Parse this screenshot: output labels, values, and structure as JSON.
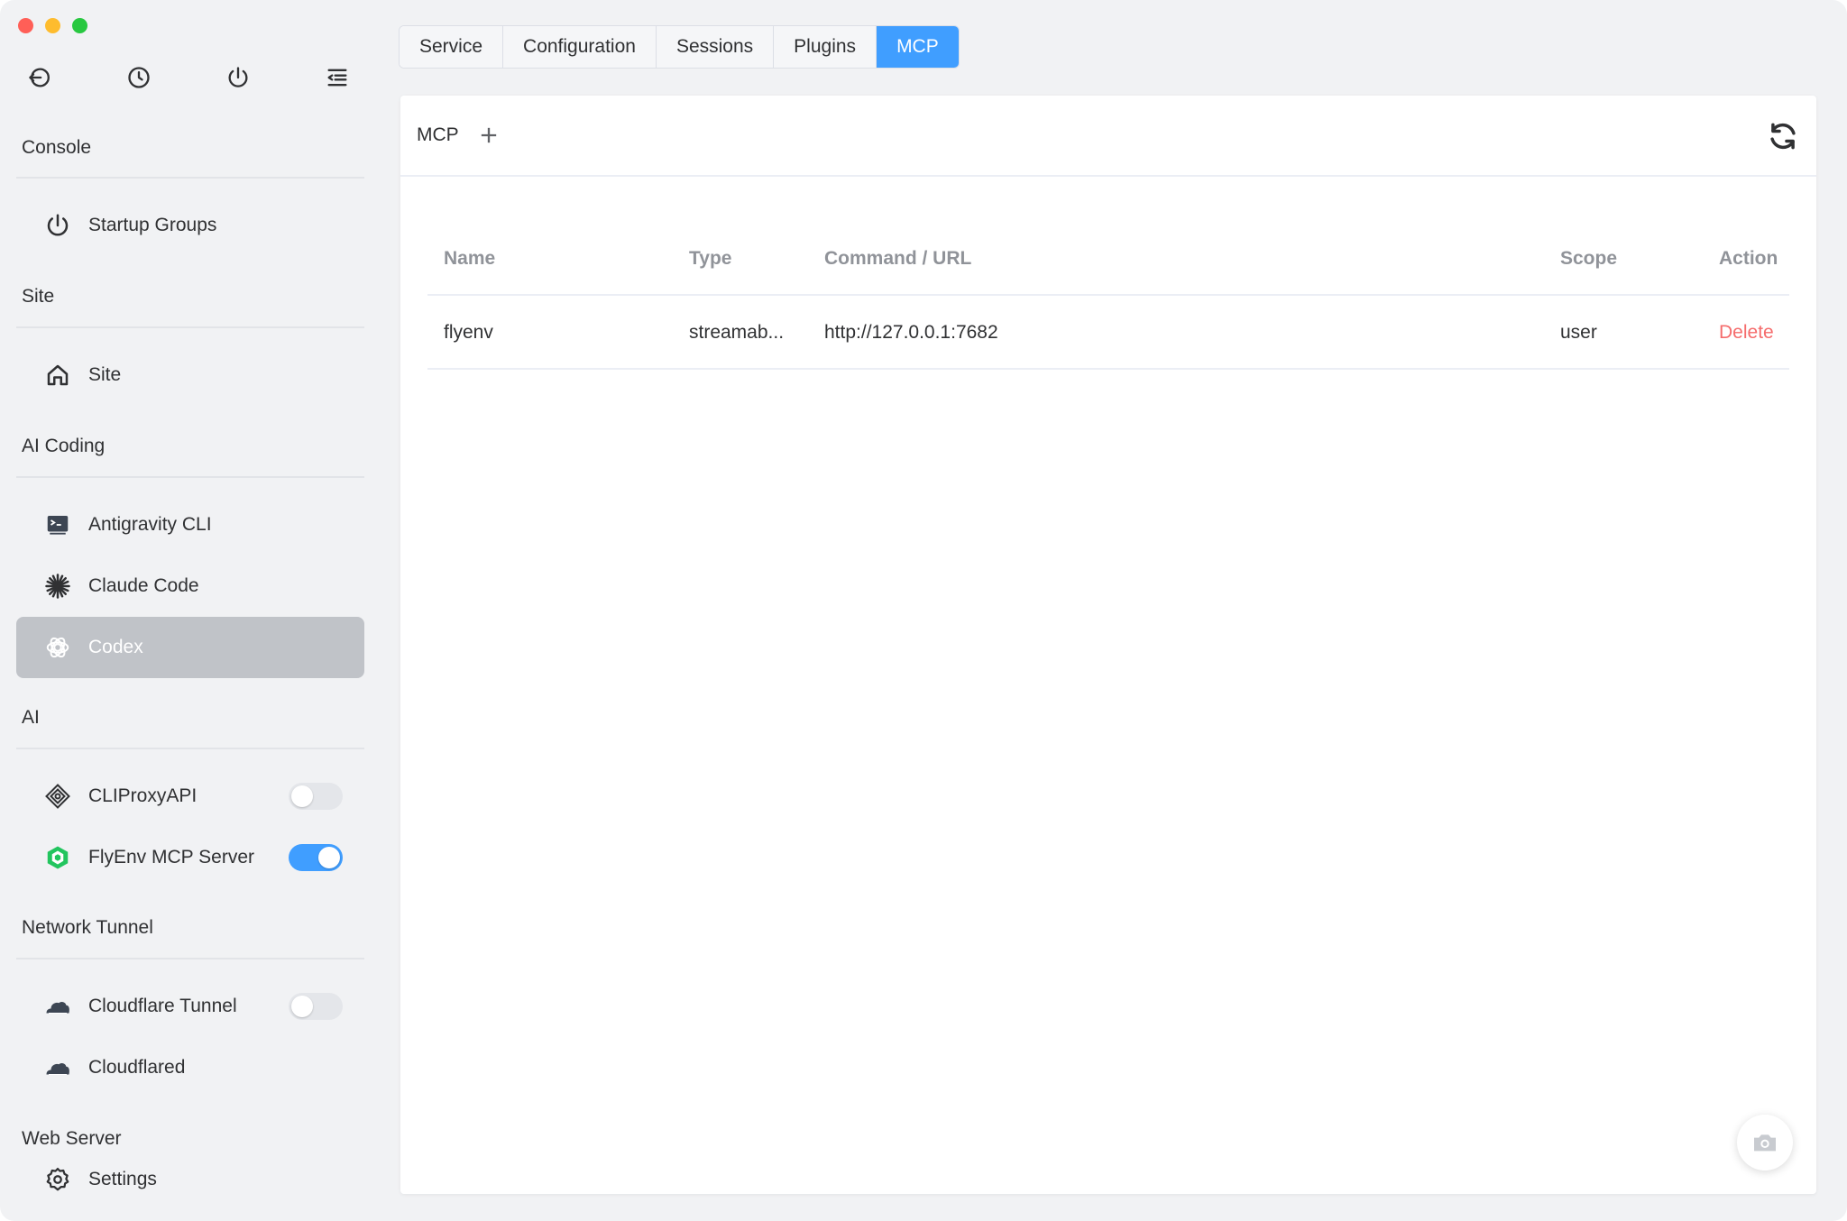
{
  "sidebar": {
    "groups": [
      {
        "title": "Console"
      },
      {
        "title": "Site"
      },
      {
        "title": "AI Coding"
      },
      {
        "title": "AI"
      },
      {
        "title": "Network Tunnel"
      },
      {
        "title": "Web Server"
      }
    ],
    "items": [
      {
        "label": "Startup Groups",
        "icon": "power-icon"
      },
      {
        "label": "Site",
        "icon": "home-icon"
      },
      {
        "label": "Antigravity CLI",
        "icon": "terminal-icon"
      },
      {
        "label": "Claude Code",
        "icon": "claude-asterisk-icon"
      },
      {
        "label": "Codex",
        "icon": "openai-icon",
        "active": true
      },
      {
        "label": "CLIProxyAPI",
        "icon": "diamond-icon",
        "toggle": false
      },
      {
        "label": "FlyEnv MCP Server",
        "icon": "cube-icon",
        "toggle": true
      },
      {
        "label": "Cloudflare Tunnel",
        "icon": "cloud-icon",
        "toggle": false
      },
      {
        "label": "Cloudflared",
        "icon": "cloud-icon"
      },
      {
        "label": "Settings",
        "icon": "gear-icon"
      }
    ]
  },
  "tabs": [
    {
      "label": "Service"
    },
    {
      "label": "Configuration"
    },
    {
      "label": "Sessions"
    },
    {
      "label": "Plugins"
    },
    {
      "label": "MCP",
      "active": true
    }
  ],
  "panel": {
    "title": "MCP"
  },
  "table": {
    "columns": [
      "Name",
      "Type",
      "Command / URL",
      "Scope",
      "Action"
    ],
    "rows": [
      {
        "name": "flyenv",
        "type": "streamab...",
        "command": "http://127.0.0.1:7682",
        "scope": "user",
        "action": "Delete"
      }
    ]
  },
  "colors": {
    "accent": "#409eff",
    "danger": "#f56c6c",
    "active_item_bg": "#c0c3c8",
    "mcp_cube": "#22c55e"
  }
}
